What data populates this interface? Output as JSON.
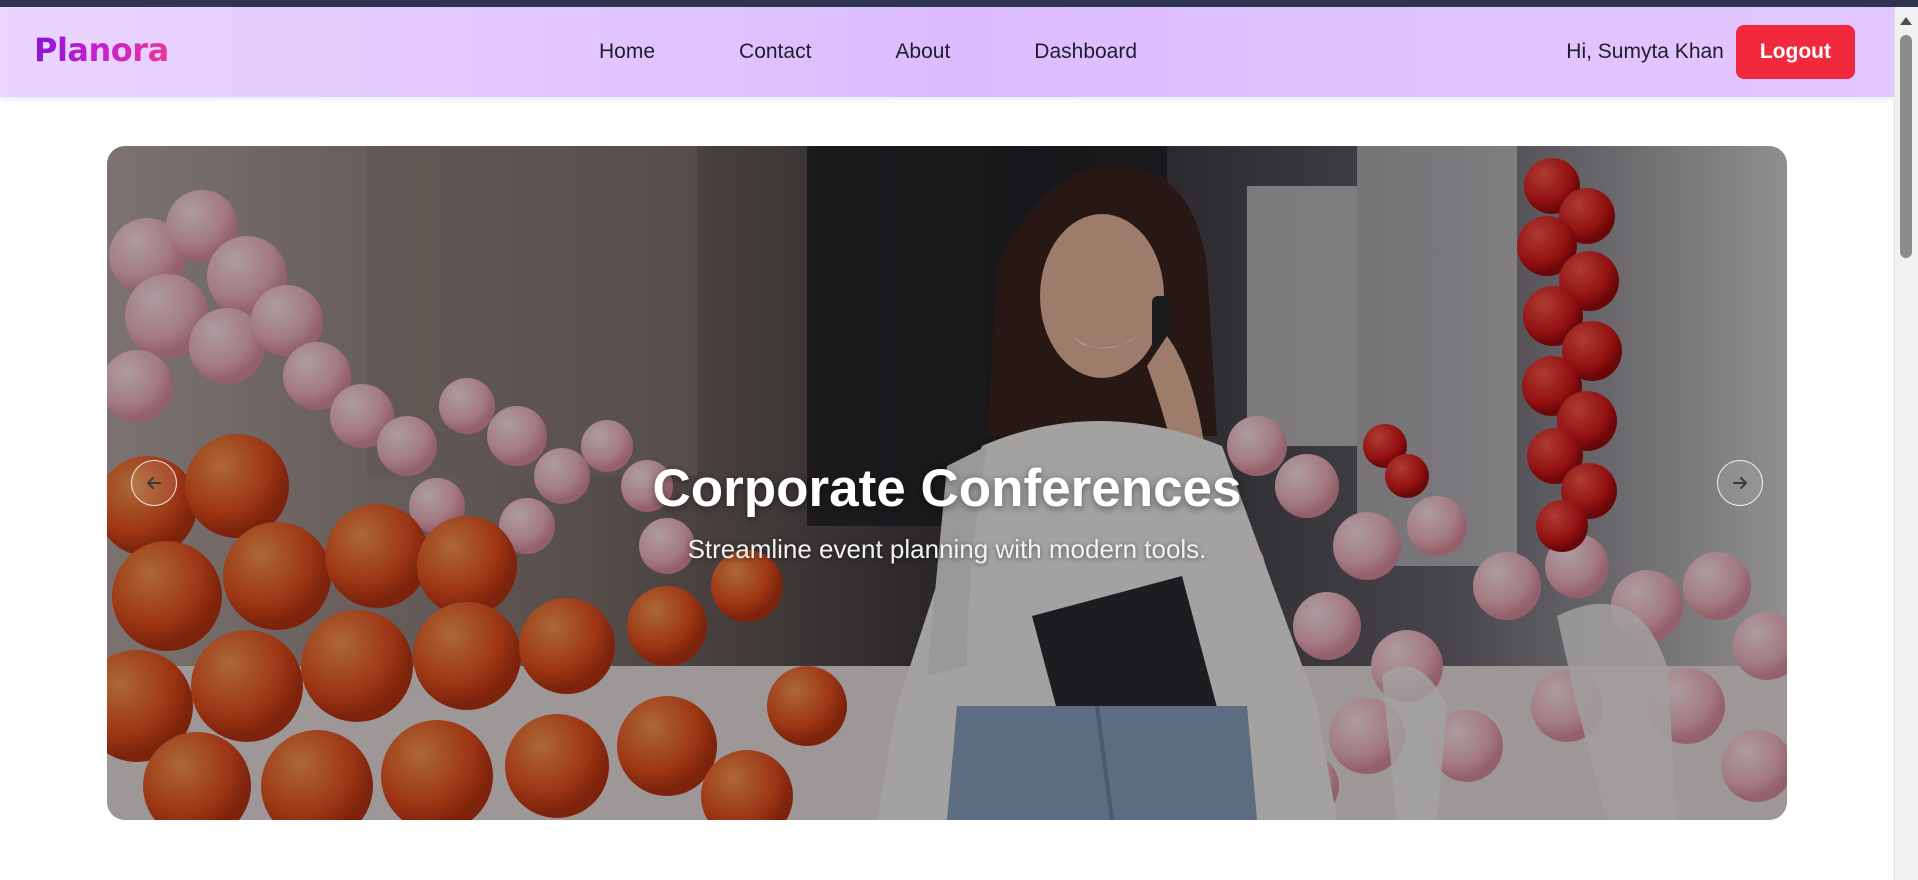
{
  "brand": {
    "name": "Planora"
  },
  "nav": {
    "links": [
      {
        "label": "Home"
      },
      {
        "label": "Contact"
      },
      {
        "label": "About"
      },
      {
        "label": "Dashboard"
      }
    ]
  },
  "user": {
    "greeting": "Hi, Sumyta Khan",
    "logout_label": "Logout"
  },
  "carousel": {
    "slide": {
      "title": "Corporate Conferences",
      "subtitle": "Streamline event planning with modern tools."
    },
    "prev_icon": "arrow-left-icon",
    "next_icon": "arrow-right-icon"
  },
  "colors": {
    "brand_gradient_start": "#8a15d8",
    "brand_gradient_end": "#e8389a",
    "navbar_bg": "#dcbcff",
    "logout_bg": "#f2283c"
  }
}
